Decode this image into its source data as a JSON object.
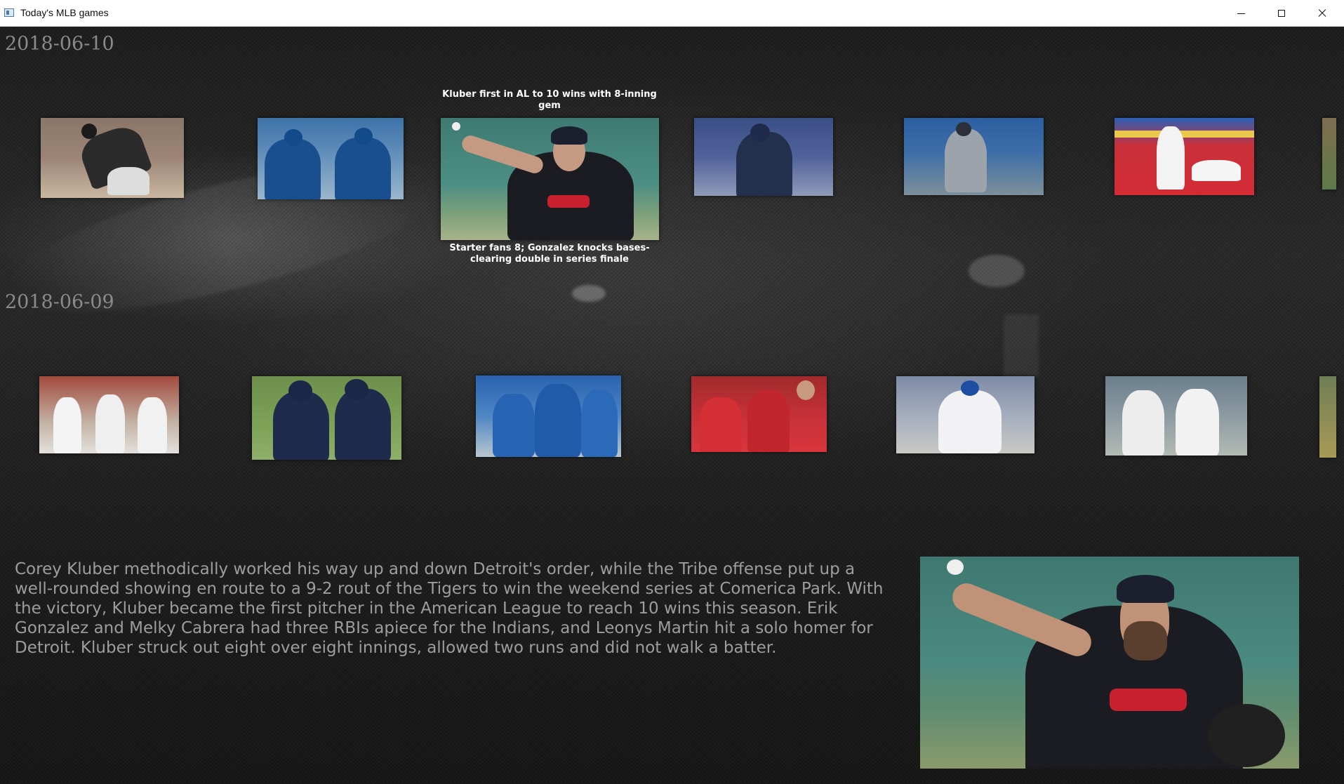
{
  "window": {
    "title": "Today's MLB games",
    "controls": [
      "minimize",
      "maximize",
      "close"
    ]
  },
  "sections": [
    {
      "date": "2018-06-10",
      "games": [
        {
          "image": "pitcher-throwing-crowd"
        },
        {
          "image": "blue-jays-celebrating"
        },
        {
          "image": "kluber-pitching",
          "selected": true,
          "headline": "Kluber first in AL to 10 wins with 8-inning gem",
          "subheadline": "Starter fans 8; Gonzalez knocks bases-clearing double in series finale"
        },
        {
          "image": "padres-pitcher"
        },
        {
          "image": "pitcher-gray-uniform"
        },
        {
          "image": "outfielder-leaping-red-wall"
        },
        {
          "image": "partial-thumbnail"
        }
      ]
    },
    {
      "date": "2018-06-09",
      "games": [
        {
          "image": "nationals-high-fives"
        },
        {
          "image": "brewers-celebrating"
        },
        {
          "image": "blue-jays-celebrating-field"
        },
        {
          "image": "angels-dugout"
        },
        {
          "image": "cubs-pitcher"
        },
        {
          "image": "red-sox-celebrating"
        },
        {
          "image": "partial-thumbnail"
        }
      ]
    }
  ],
  "detail": {
    "summary": "Corey Kluber methodically worked his way up and down Detroit's order, while the Tribe offense put up a well-rounded showing en route to a 9-2 rout of the Tigers to win the weekend series at Comerica Park. With the victory, Kluber became the first pitcher in the American League to reach 10 wins this season. Erik Gonzalez and Melky Cabrera had three RBIs apiece for the Indians, and Leonys Martin hit a solo homer for Detroit. Kluber struck out eight over eight innings, allowed two runs and did not walk a batter.",
    "image": "kluber-pitching-large"
  },
  "colors": {
    "background": "#1a1a1a",
    "date_text": "#8a8a8a",
    "summary_text": "#9d9d9d",
    "caption_text": "#ffffff"
  }
}
